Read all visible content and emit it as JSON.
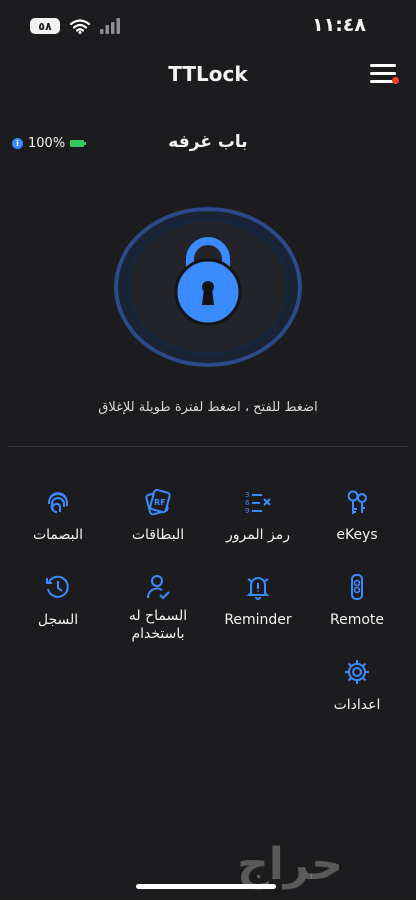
{
  "status_bar": {
    "time": "١١:٤٨",
    "battery": "٥٨"
  },
  "header": {
    "title": "TTLock"
  },
  "lock": {
    "battery_percent": "100%",
    "name": "باب غرفه",
    "hint": "اضغط للفتح ، اضغط لفترة طويلة للإغلاق"
  },
  "menu": {
    "ekeys": "eKeys",
    "passcodes": "رمز المرور",
    "cards": "البطاقات",
    "fingerprints": "البصمات",
    "remote": "Remote",
    "reminder": "Reminder",
    "authorized_admin": [
      "السماح له",
      "باستخدام"
    ],
    "records": "السجل",
    "settings": "اعدادات"
  },
  "watermark": "حراج",
  "colors": {
    "accent": "#3a8bff",
    "background": "#1c1c1e",
    "notification": "#ff3b30",
    "battery": "#34c759"
  },
  "icons": [
    "key-icon",
    "passcode-icon",
    "card-icon",
    "fingerprint-icon",
    "remote-icon",
    "bell-icon",
    "user-check-icon",
    "clock-history-icon",
    "gear-icon"
  ]
}
